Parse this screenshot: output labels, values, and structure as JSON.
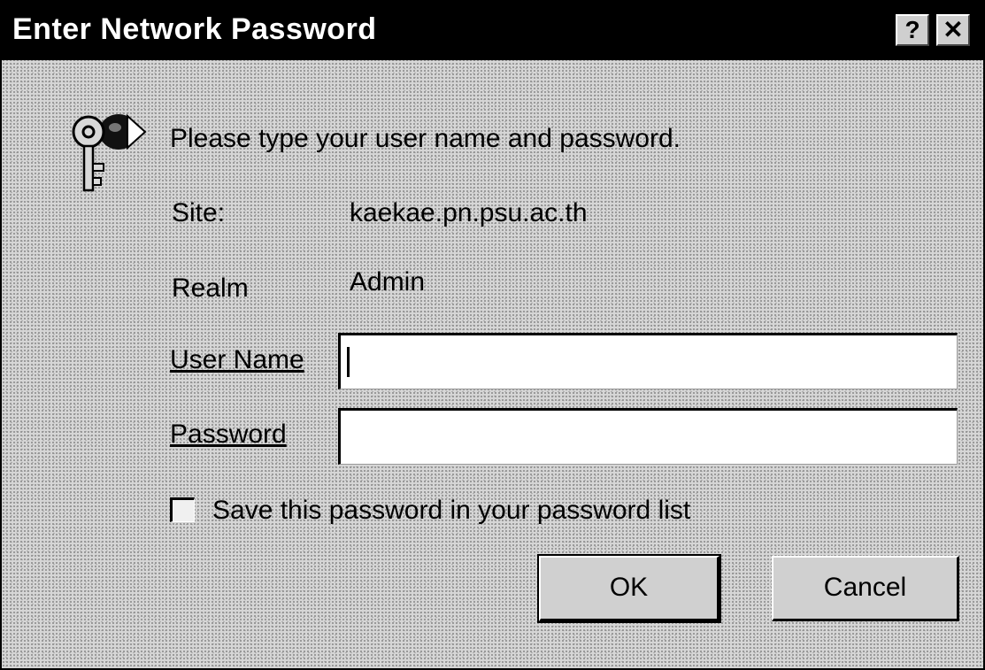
{
  "window": {
    "title": "Enter Network Password",
    "help_button": "?",
    "close_button": "✕"
  },
  "dialog": {
    "prompt": "Please type your user name and password.",
    "site_label": "Site:",
    "site_value": "kaekae.pn.psu.ac.th",
    "realm_label": "Realm",
    "realm_value": "Admin",
    "user_name_label": "User Name",
    "user_name_value": "",
    "password_label": "Password",
    "password_value": "",
    "save_password_label": "Save this password in your password list",
    "save_password_checked": false,
    "icon": "key-icon"
  },
  "buttons": {
    "ok_label": "OK",
    "cancel_label": "Cancel"
  }
}
